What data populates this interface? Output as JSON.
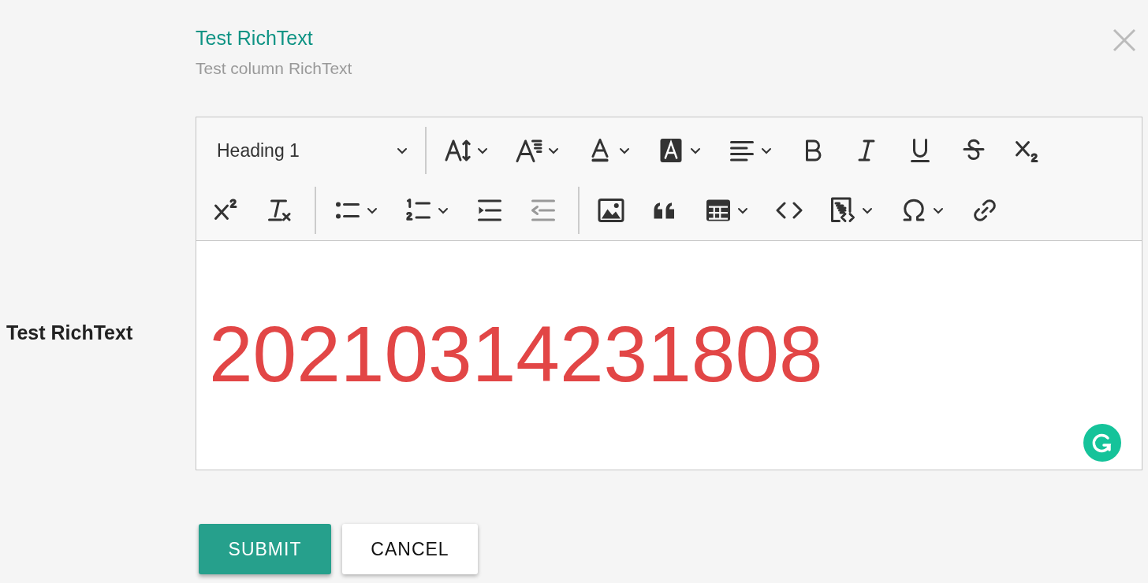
{
  "header": {
    "title": "Test RichText",
    "subtitle": "Test column RichText"
  },
  "field": {
    "label": "Test RichText",
    "toolbar": {
      "rows": [
        [
          {
            "kind": "heading",
            "text": "Heading 1",
            "dropdown": true,
            "disabled": false
          },
          {
            "kind": "separator"
          },
          {
            "kind": "font-size",
            "dropdown": true,
            "disabled": false
          },
          {
            "kind": "font-family",
            "dropdown": true,
            "disabled": false
          },
          {
            "kind": "font-color",
            "dropdown": true,
            "disabled": false
          },
          {
            "kind": "highlight",
            "dropdown": true,
            "disabled": false
          },
          {
            "kind": "align",
            "dropdown": true,
            "disabled": false
          },
          {
            "kind": "bold",
            "dropdown": false,
            "disabled": false
          },
          {
            "kind": "italic",
            "dropdown": false,
            "disabled": false
          },
          {
            "kind": "underline",
            "dropdown": false,
            "disabled": false
          },
          {
            "kind": "strikethrough",
            "dropdown": false,
            "disabled": false
          },
          {
            "kind": "subscript",
            "dropdown": false,
            "disabled": false
          }
        ],
        [
          {
            "kind": "superscript",
            "dropdown": false,
            "disabled": false
          },
          {
            "kind": "remove-format",
            "dropdown": false,
            "disabled": false
          },
          {
            "kind": "separator"
          },
          {
            "kind": "bulleted-list",
            "dropdown": true,
            "disabled": false
          },
          {
            "kind": "numbered-list",
            "dropdown": true,
            "disabled": false
          },
          {
            "kind": "indent",
            "dropdown": false,
            "disabled": false
          },
          {
            "kind": "outdent",
            "dropdown": false,
            "disabled": true
          },
          {
            "kind": "separator"
          },
          {
            "kind": "image",
            "dropdown": false,
            "disabled": false
          },
          {
            "kind": "quote",
            "dropdown": false,
            "disabled": false
          },
          {
            "kind": "table",
            "dropdown": true,
            "disabled": false
          },
          {
            "kind": "code",
            "dropdown": false,
            "disabled": false
          },
          {
            "kind": "source",
            "dropdown": true,
            "disabled": false
          },
          {
            "kind": "special-characters",
            "dropdown": true,
            "disabled": false
          },
          {
            "kind": "link",
            "dropdown": false,
            "disabled": false
          }
        ]
      ]
    },
    "content": "20210314231808"
  },
  "buttons": [
    {
      "label": "SUBMIT",
      "kind": "primary"
    },
    {
      "label": "CANCEL",
      "kind": "secondary"
    }
  ]
}
